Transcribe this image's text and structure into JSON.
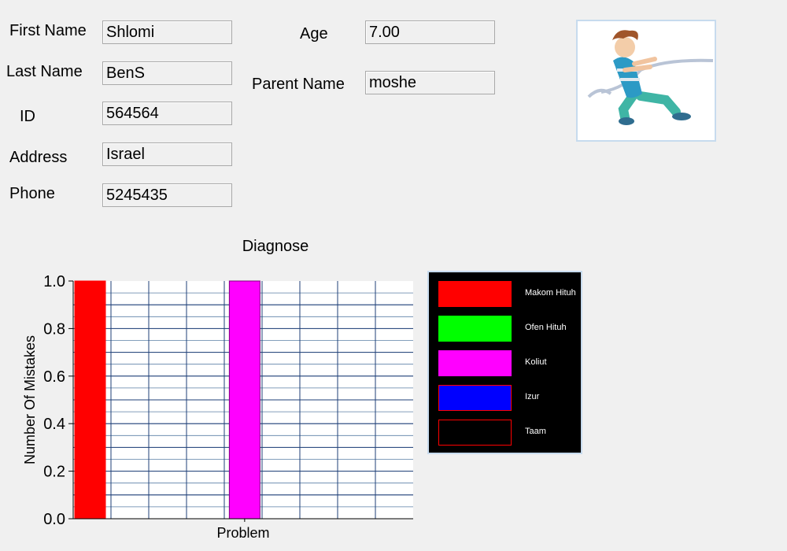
{
  "form": {
    "first_name": {
      "label": "First Name",
      "value": "Shlomi"
    },
    "last_name": {
      "label": "Last Name",
      "value": "BenS"
    },
    "id": {
      "label": "ID",
      "value": "564564"
    },
    "address": {
      "label": "Address",
      "value": "Israel"
    },
    "phone": {
      "label": "Phone",
      "value": "5245435"
    },
    "age": {
      "label": "Age",
      "value": "7.00"
    },
    "parent_name": {
      "label": "Parent Name",
      "value": "moshe"
    }
  },
  "photo": {
    "description": "cartoon boy pulling a rope",
    "icon": "tug-of-war-boy-image"
  },
  "chart_data": {
    "type": "bar",
    "title": "Diagnose",
    "xlabel": "Problem",
    "ylabel": "Number Of Mistakes",
    "ylim": [
      0,
      1.0
    ],
    "y_ticks": [
      "0.0",
      "0.2",
      "0.4",
      "0.6",
      "0.8",
      "1.0"
    ],
    "grid": true,
    "legend_position": "right",
    "series": [
      {
        "name": "Makom Hituh",
        "value": 1.0,
        "color": "#ff0000"
      },
      {
        "name": "Ofen Hituh",
        "value": 0,
        "color": "#00ff00"
      },
      {
        "name": "Koliut",
        "value": 1.0,
        "color": "#ff00ff"
      },
      {
        "name": "Izur",
        "value": 0,
        "color": "#0000ff"
      },
      {
        "name": "Taam",
        "value": 0,
        "color": "#000000"
      }
    ]
  },
  "legend": {
    "items": [
      {
        "label": "Makom Hituh",
        "color": "#ff0000",
        "border": "#ff0000"
      },
      {
        "label": "Ofen Hituh",
        "color": "#00ff00",
        "border": "#00ff00"
      },
      {
        "label": "Koliut",
        "color": "#ff00ff",
        "border": "#ff00ff"
      },
      {
        "label": "Izur",
        "color": "#0000ff",
        "border": "#ff0000"
      },
      {
        "label": "Taam",
        "color": "#000000",
        "border": "#ff0000"
      }
    ]
  }
}
